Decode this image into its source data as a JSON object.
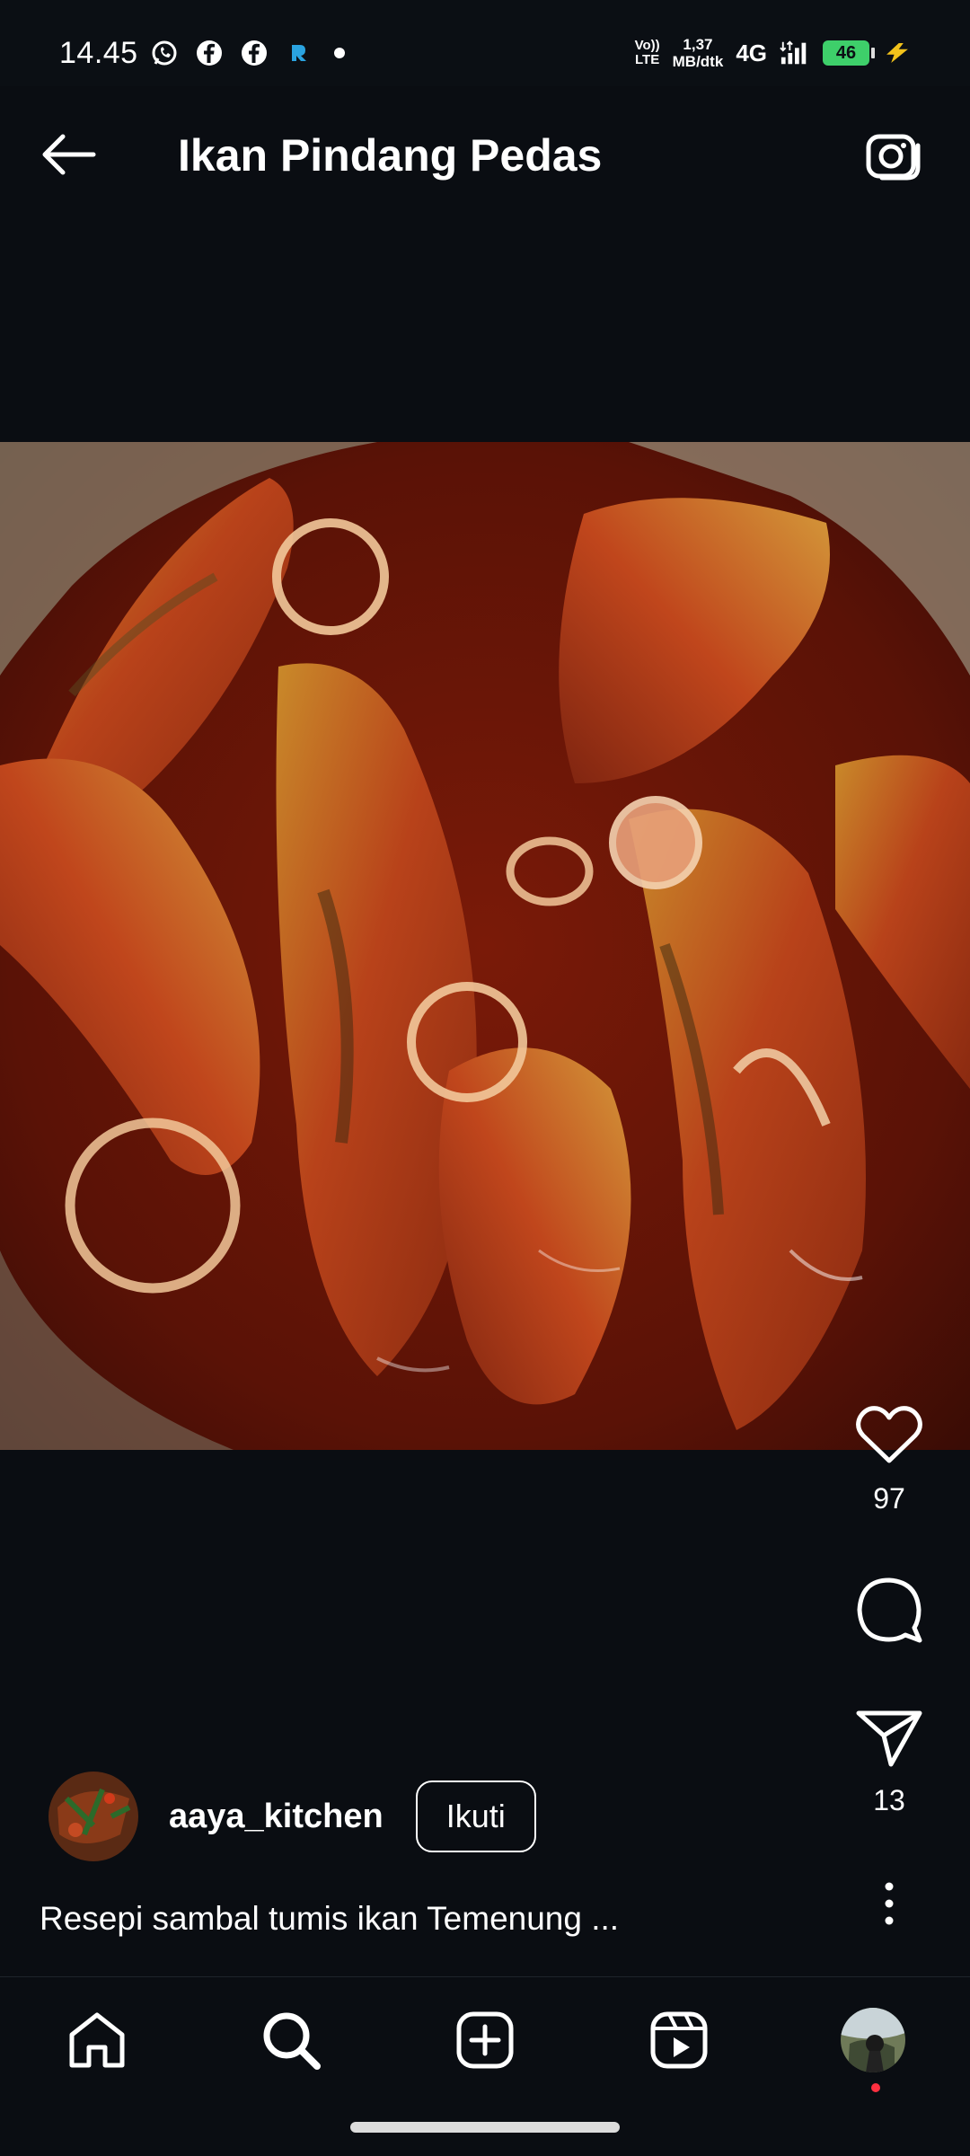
{
  "status_bar": {
    "time": "14.45",
    "volte_top": "Vo))",
    "volte_bottom": "LTE",
    "speed_value": "1,37",
    "speed_unit": "MB/dtk",
    "network": "4G",
    "battery": "46",
    "icons": [
      "whatsapp-icon",
      "facebook-icon",
      "facebook-icon",
      "app-r-icon",
      "notification-dot",
      "signal-icon",
      "charging-bolt-icon"
    ]
  },
  "header": {
    "title": "Ikan Pindang Pedas",
    "back_icon": "arrow-left-icon",
    "camera_icon": "camera-icon"
  },
  "post": {
    "likes": "97",
    "shares": "13",
    "author": "aaya_kitchen",
    "follow_label": "Ikuti",
    "caption": "Resepi sambal tumis ikan Temenung ..."
  },
  "bottom_nav": {
    "items": [
      "home-icon",
      "search-icon",
      "create-icon",
      "reels-icon",
      "profile-avatar"
    ]
  },
  "colors": {
    "background": "#0a0d12",
    "text": "#ffffff",
    "battery": "#3ecf6a",
    "notification_dot": "#ff3040"
  }
}
